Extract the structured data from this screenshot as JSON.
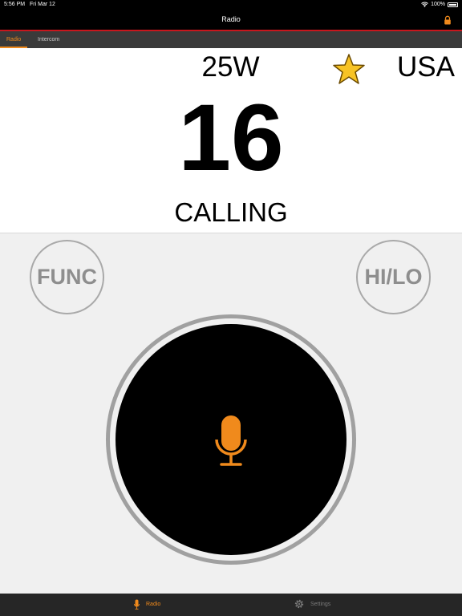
{
  "status_bar": {
    "time": "5:56 PM",
    "date": "Fri Mar 12",
    "battery": "100%"
  },
  "nav": {
    "title": "Radio"
  },
  "top_tabs": [
    {
      "label": "Radio"
    },
    {
      "label": "Intercom"
    }
  ],
  "display": {
    "power": "25W",
    "region": "USA",
    "channel": "16",
    "status": "CALLING"
  },
  "controls": {
    "func_label": "FUNC",
    "hilo_label": "HI/LO"
  },
  "tab_bar": [
    {
      "label": "Radio",
      "icon": "microphone-icon"
    },
    {
      "label": "Settings",
      "icon": "gear-icon"
    }
  ],
  "colors": {
    "accent": "#f08a1c",
    "nav_underline": "#c8161d",
    "star": "#f7c325"
  }
}
